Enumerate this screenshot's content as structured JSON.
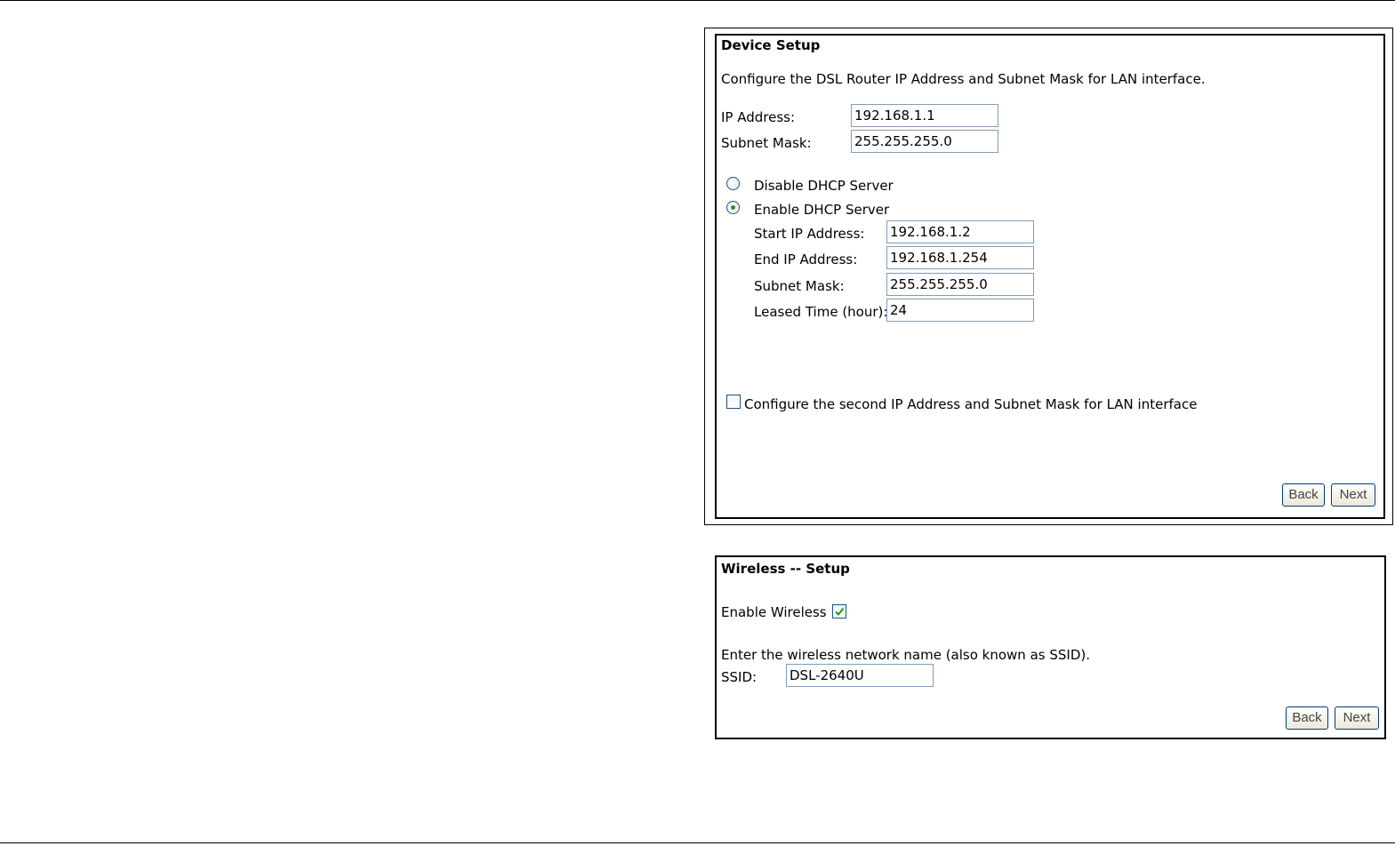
{
  "device_setup": {
    "title": "Device Setup",
    "description": "Configure the DSL Router IP Address and Subnet Mask for LAN interface.",
    "ip_address_label": "IP Address:",
    "ip_address_value": "192.168.1.1",
    "subnet_mask_label": "Subnet Mask:",
    "subnet_mask_value": "255.255.255.0",
    "dhcp": {
      "disable_label": "Disable DHCP Server",
      "enable_label": "Enable DHCP Server",
      "selected": "enable",
      "start_ip_label": "Start IP Address:",
      "start_ip_value": "192.168.1.2",
      "end_ip_label": "End IP Address:",
      "end_ip_value": "192.168.1.254",
      "subnet_mask_label": "Subnet Mask:",
      "subnet_mask_value": "255.255.255.0",
      "leased_time_label": "Leased Time (hour):",
      "leased_time_value": "24"
    },
    "second_ip_label": "Configure the second IP Address and Subnet Mask for LAN interface",
    "second_ip_checked": false,
    "back_label": "Back",
    "next_label": "Next"
  },
  "wireless_setup": {
    "title": "Wireless -- Setup",
    "enable_wireless_label": "Enable Wireless",
    "enable_wireless_checked": true,
    "ssid_prompt": "Enter the wireless network name (also known as SSID).",
    "ssid_label": "SSID:",
    "ssid_value": "DSL-2640U",
    "back_label": "Back",
    "next_label": "Next"
  },
  "colors": {
    "check_green": "#1d9a1d",
    "input_border": "#7f9db9",
    "control_border": "#1c5180"
  }
}
